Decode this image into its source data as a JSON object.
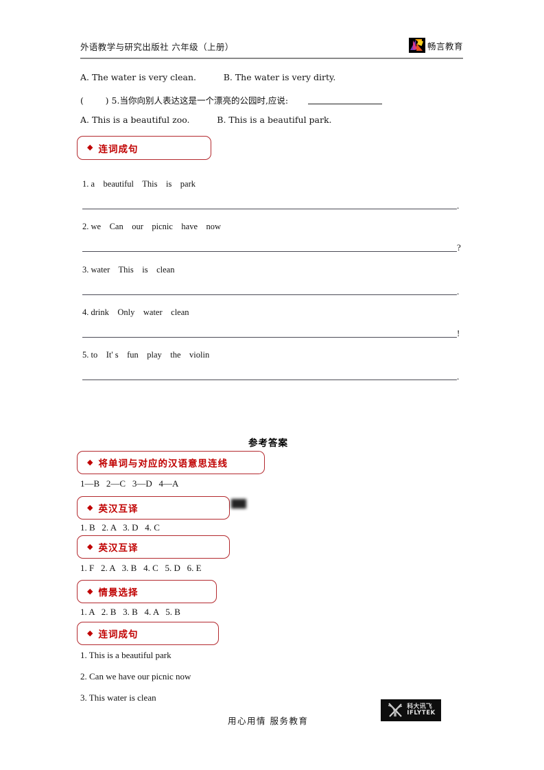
{
  "header": {
    "title": "外语教学与研究出版社  六年级（上册）",
    "logo_name": "changyan-bird-logo",
    "logo_text": "畅言教育"
  },
  "top_questions": {
    "options_line_4": "A. The water is very clean.          B. The water is very dirty.",
    "question_5": "(        ) 5.当你向别人表达这是一个漂亮的公园时,应说:",
    "options_line_5": "A. This is a beautiful zoo.          B. This is a beautiful park."
  },
  "section_rearrange": {
    "label": "连词成句",
    "items": [
      {
        "text": "1. a    beautiful    This    is    park",
        "end_mark": "."
      },
      {
        "text": "2. we    Can    our    picnic    have    now",
        "end_mark": "?"
      },
      {
        "text": "3. water    This    is    clean",
        "end_mark": "."
      },
      {
        "text": "4. drink    Only    water    clean",
        "end_mark": "!"
      },
      {
        "text": "5. to    It' s    fun    play    the    violin",
        "end_mark": "."
      }
    ]
  },
  "answer_key": {
    "title": "参考答案",
    "sections": [
      {
        "label": "将单词与对应的汉语意思连线",
        "answers": "1—B   2—C   3—D   4—A"
      },
      {
        "label": "英汉互译",
        "answers": "1. B   2. A   3. D   4. C"
      },
      {
        "label": "英汉互译",
        "answers": "1. F   2. A   3. B   4. C   5. D   6. E"
      },
      {
        "label": "情景选择",
        "answers": "1. A   2. B   3. B   4. A   5. B"
      },
      {
        "label": "连词成句",
        "answers": ""
      }
    ],
    "sentence_answers": [
      "1. This is a beautiful park",
      "2. Can we have our picnic now",
      "3. This water is clean"
    ]
  },
  "footer": {
    "slogan": "用心用情    服务教育",
    "logo_name": "iflytek-logo",
    "logo_cn": "科大讯飞",
    "logo_en": "IFLYTEK"
  },
  "colors": {
    "accent_red": "#c00000",
    "box_border": "#b3282d",
    "rule_gray": "#8a8a8a"
  }
}
